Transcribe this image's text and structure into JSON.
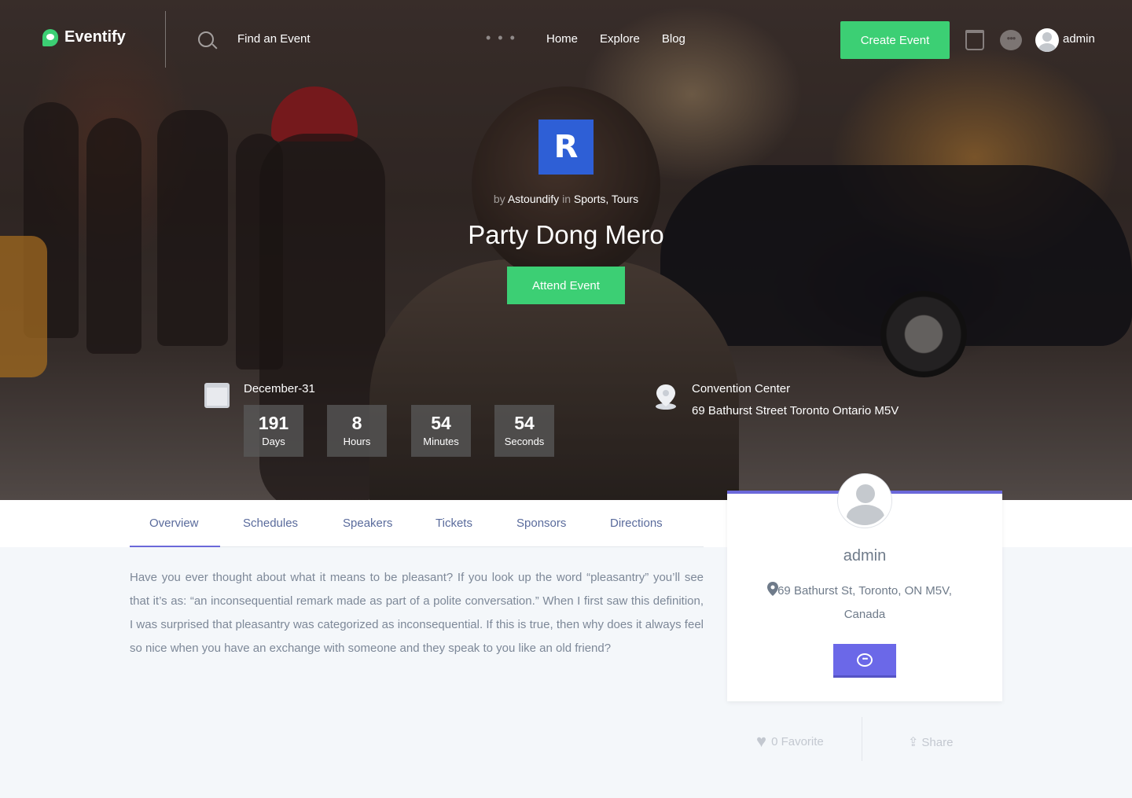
{
  "header": {
    "brand": "Eventify",
    "find_event": "Find an Event",
    "nav": [
      "Home",
      "Explore",
      "Blog"
    ],
    "create_event": "Create Event",
    "username": "admin"
  },
  "event": {
    "logo_letter": "R",
    "by_prefix": "by",
    "organizer": "Astoundify",
    "in_prefix": "in",
    "categories": "Sports, Tours",
    "title": "Party Dong Mero",
    "attend_button": "Attend Event",
    "date": "December-31",
    "countdown": [
      {
        "value": "191",
        "label": "Days"
      },
      {
        "value": "8",
        "label": "Hours"
      },
      {
        "value": "54",
        "label": "Minutes"
      },
      {
        "value": "54",
        "label": "Seconds"
      }
    ],
    "venue_name": "Convention Center",
    "venue_address": "69 Bathurst Street Toronto Ontario M5V"
  },
  "tabs": [
    "Overview",
    "Schedules",
    "Speakers",
    "Tickets",
    "Sponsors",
    "Directions"
  ],
  "active_tab": "Overview",
  "description": "Have you ever thought about what it means to be pleasant? If you look up the word “pleasantry” you’ll see that it’s as: “an inconsequential remark made as part of a polite conversation.” When I first saw this definition, I was surprised that pleasantry was categorized as inconsequential. If this is true, then why does it always feel so nice when you have an exchange with someone and they speak to you like an old friend?",
  "profile_card": {
    "name": "admin",
    "address": "69 Bathurst St, Toronto, ON M5V, Canada"
  },
  "actions": {
    "favorite": "0 Favorite",
    "share": "Share"
  },
  "colors": {
    "accent_green": "#3ccf74",
    "accent_purple": "#6b68e8",
    "logo_blue": "#2e5fd6"
  }
}
